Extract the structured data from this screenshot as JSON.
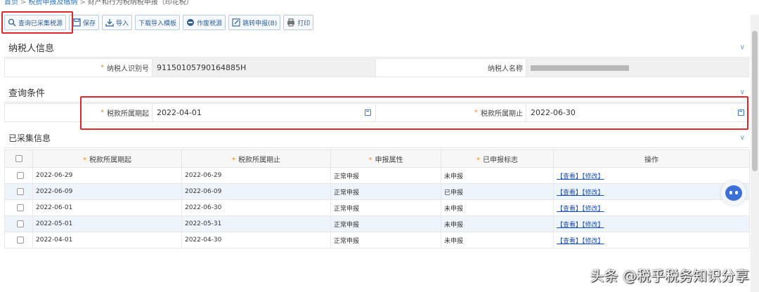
{
  "breadcrumb": {
    "home": "首页",
    "level2": "税费申报及缴纳",
    "current": "财产和行为税纳税申报（印花税）"
  },
  "toolbar": {
    "query_collected": "查询已采集税源",
    "save": "保存",
    "import": "导入",
    "download_template": "下载导入模板",
    "void_source": "作废税源",
    "jump_declare": "跳转申报(B)",
    "print": "打印"
  },
  "taxpayer": {
    "title": "纳税人信息",
    "id_label": "纳税人识别号",
    "id_value": "91150105790164885H",
    "name_label": "纳税人名称"
  },
  "query": {
    "title": "查询条件",
    "start_label": "税款所属期起",
    "start_value": "2022-04-01",
    "end_label": "税款所属期止",
    "end_value": "2022-06-30"
  },
  "collected": {
    "title": "已采集信息",
    "columns": [
      "税款所属期起",
      "税款所属期止",
      "申报属性",
      "已申报标志",
      "操作"
    ],
    "rows": [
      {
        "start": "2022-06-29",
        "end": "2022-06-29",
        "attr": "正常申报",
        "flag": "未申报",
        "view": "【查看】",
        "edit": "【修改】"
      },
      {
        "start": "2022-06-09",
        "end": "2022-06-09",
        "attr": "正常申报",
        "flag": "已申报",
        "view": "【查看】",
        "edit": "【修改】"
      },
      {
        "start": "2022-06-01",
        "end": "2022-06-30",
        "attr": "正常申报",
        "flag": "未申报",
        "view": "【查看】",
        "edit": "【修改】"
      },
      {
        "start": "2022-05-01",
        "end": "2022-05-31",
        "attr": "正常申报",
        "flag": "未申报",
        "view": "【查看】",
        "edit": "【修改】"
      },
      {
        "start": "2022-04-01",
        "end": "2022-04-30",
        "attr": "正常申报",
        "flag": "未申报",
        "view": "【查看】",
        "edit": "【修改】"
      }
    ]
  },
  "watermark": "头条 @税乎税务知识分享",
  "colors": {
    "highlight": "#e0262a",
    "link": "#1a4fb5",
    "required": "#f08a1c",
    "row_alt": "#eef4fb"
  },
  "icons": [
    "search-icon",
    "save-icon",
    "import-icon",
    "void-icon",
    "edit-icon",
    "print-icon",
    "calendar-icon",
    "chevron-down-icon",
    "chatbot-icon"
  ]
}
